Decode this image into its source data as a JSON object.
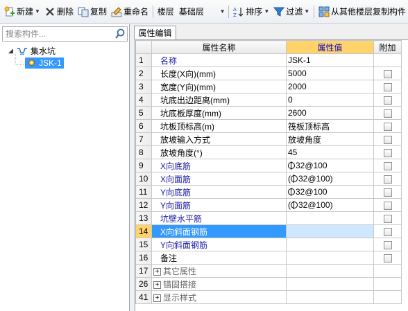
{
  "toolbar": {
    "new_label": "新建",
    "delete_label": "删除",
    "copy_label": "复制",
    "rename_label": "重命名",
    "floor_label": "楼层",
    "floor_value": "基础层",
    "sort_label": "排序",
    "filter_label": "过滤",
    "copy_from_floor_label": "从其他楼层复制构件"
  },
  "left": {
    "search_placeholder": "搜索构件...",
    "tree": {
      "parent_label": "集水坑",
      "child_label": "JSK-1"
    }
  },
  "right": {
    "tab_label": "属性编辑",
    "headers": {
      "name": "属性名称",
      "value": "属性值",
      "extra": "附加"
    },
    "rows": [
      {
        "num": "1",
        "name": "名称",
        "value": "JSK-1",
        "kind": "blue",
        "checkbox": false
      },
      {
        "num": "2",
        "name": "长度(X向)(mm)",
        "value": "5000",
        "kind": "plain",
        "checkbox": true
      },
      {
        "num": "3",
        "name": "宽度(Y向)(mm)",
        "value": "2000",
        "kind": "plain",
        "checkbox": true
      },
      {
        "num": "4",
        "name": "坑底出边距离(mm)",
        "value": "0",
        "kind": "plain",
        "checkbox": true
      },
      {
        "num": "5",
        "name": "坑底板厚度(mm)",
        "value": "2600",
        "kind": "plain",
        "checkbox": true
      },
      {
        "num": "6",
        "name": "坑板顶标高(m)",
        "value": "筏板顶标高",
        "kind": "plain",
        "checkbox": true
      },
      {
        "num": "7",
        "name": "放坡输入方式",
        "value": "放坡角度",
        "kind": "plain",
        "checkbox": true
      },
      {
        "num": "8",
        "name": "放坡角度(°)",
        "value": "45",
        "kind": "plain",
        "checkbox": true
      },
      {
        "num": "9",
        "name": "X向底筋",
        "value": "32@100",
        "rebar": true,
        "paren": false,
        "kind": "blue",
        "checkbox": true
      },
      {
        "num": "10",
        "name": "X向面筋",
        "value": "32@100",
        "rebar": true,
        "paren": true,
        "kind": "blue",
        "checkbox": true
      },
      {
        "num": "11",
        "name": "Y向底筋",
        "value": "32@100",
        "rebar": true,
        "paren": false,
        "kind": "blue",
        "checkbox": true
      },
      {
        "num": "12",
        "name": "Y向面筋",
        "value": "32@100",
        "rebar": true,
        "paren": true,
        "kind": "blue",
        "checkbox": true
      },
      {
        "num": "13",
        "name": "坑壁水平筋",
        "value": "",
        "kind": "blue",
        "checkbox": true
      },
      {
        "num": "14",
        "name": "X向斜面钢筋",
        "value": "",
        "kind": "blue",
        "checkbox": true,
        "selected": true
      },
      {
        "num": "15",
        "name": "Y向斜面钢筋",
        "value": "",
        "kind": "blue",
        "checkbox": true
      },
      {
        "num": "16",
        "name": "备注",
        "value": "",
        "kind": "plain",
        "checkbox": true
      },
      {
        "num": "17",
        "name": "其它属性",
        "value": "",
        "kind": "group",
        "checkbox": false
      },
      {
        "num": "26",
        "name": "锚固搭接",
        "value": "",
        "kind": "group",
        "checkbox": false
      },
      {
        "num": "41",
        "name": "显示样式",
        "value": "",
        "kind": "group",
        "checkbox": false
      }
    ]
  }
}
